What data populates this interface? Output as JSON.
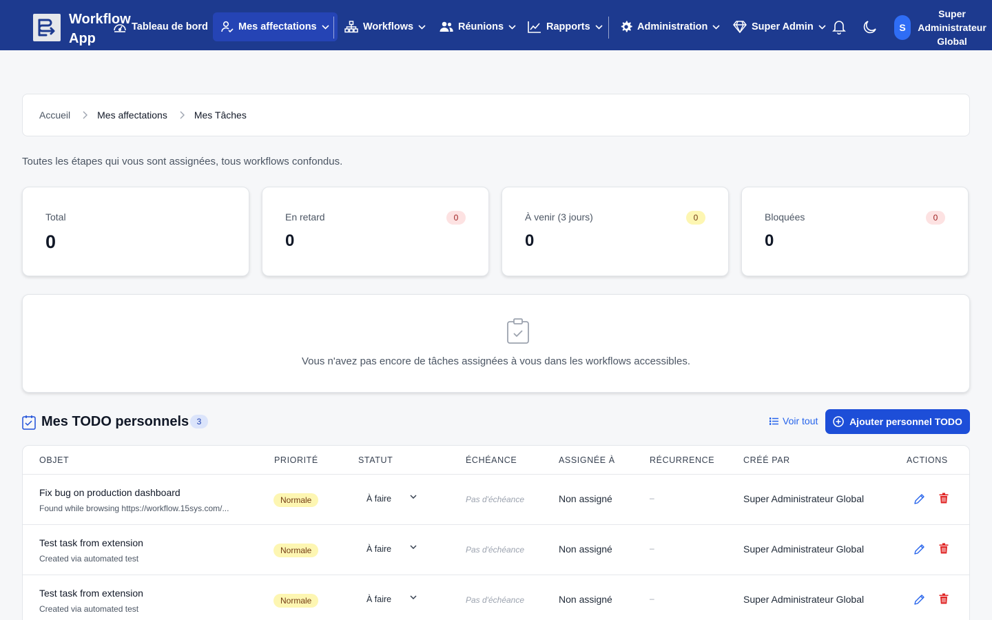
{
  "app": {
    "title": "Workflow App"
  },
  "nav": {
    "dashboard": "Tableau de bord",
    "assignments": "Mes affectations",
    "workflows": "Workflows",
    "meetings": "Réunions",
    "reports": "Rapports",
    "administration": "Administration",
    "super_admin": "Super Admin"
  },
  "user": {
    "initial": "S",
    "name": "Super Administrateur Global"
  },
  "breadcrumb": [
    "Accueil",
    "Mes affectations",
    "Mes Tâches"
  ],
  "subtitle": "Toutes les étapes qui vous sont assignées, tous workflows confondus.",
  "stats": [
    {
      "label": "Total",
      "value": "0",
      "badge": null
    },
    {
      "label": "En retard",
      "value": "0",
      "badge": "0",
      "badge_color": "#fde2e2"
    },
    {
      "label": "À venir (3 jours)",
      "value": "0",
      "badge": "0",
      "badge_color": "#fdf6b2"
    },
    {
      "label": "Bloquées",
      "value": "0",
      "badge": "0",
      "badge_color": "#fde2e2"
    }
  ],
  "empty_state": {
    "text": "Vous n'avez pas encore de tâches assignées à vous dans les workflows accessibles."
  },
  "todos": {
    "title": "Mes TODO personnels",
    "count": "3",
    "see_all": "Voir tout",
    "add_button": "Ajouter personnel TODO",
    "columns": [
      "OBJET",
      "PRIORITÉ",
      "STATUT",
      "ÉCHÉANCE",
      "ASSIGNÉE À",
      "RÉCURRENCE",
      "CRÉÉ PAR",
      "ACTIONS"
    ],
    "rows": [
      {
        "title": "Fix bug on production dashboard",
        "subtitle": "Found while browsing https://workflow.15sys.com/...",
        "priority": "Normale",
        "status": "À faire",
        "due": "Pas d'échéance",
        "assigned": "Non assigné",
        "recurrence": "–",
        "creator": "Super Administrateur Global"
      },
      {
        "title": "Test task from extension",
        "subtitle": "Created via automated test",
        "priority": "Normale",
        "status": "À faire",
        "due": "Pas d'échéance",
        "assigned": "Non assigné",
        "recurrence": "–",
        "creator": "Super Administrateur Global"
      },
      {
        "title": "Test task from extension",
        "subtitle": "Created via automated test",
        "priority": "Normale",
        "status": "À faire",
        "due": "Pas d'échéance",
        "assigned": "Non assigné",
        "recurrence": "–",
        "creator": "Super Administrateur Global"
      }
    ]
  },
  "colors": {
    "nav_bg": "#1d3a8f",
    "nav_active": "#2544b5",
    "primary": "#1d4ed8",
    "link": "#2563eb",
    "danger": "#e02424"
  }
}
